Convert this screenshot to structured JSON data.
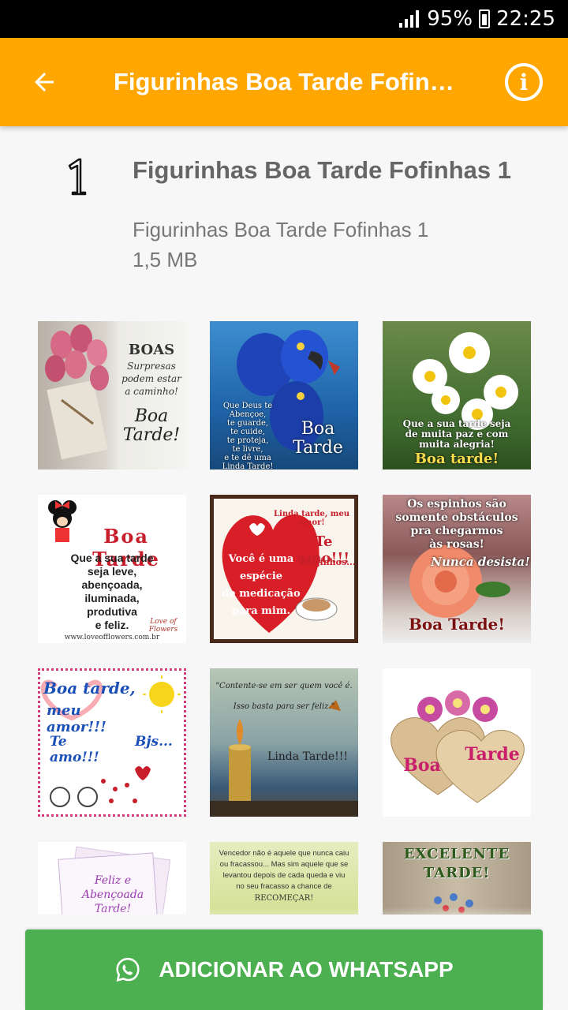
{
  "status_bar": {
    "battery": "95%",
    "time": "22:25"
  },
  "app_bar": {
    "title": "Figurinhas Boa Tarde Fofinhas 1"
  },
  "pack": {
    "tray_number": "1",
    "name": "Figurinhas Boa Tarde Fofinhas 1",
    "publisher": "Figurinhas Boa Tarde Fofinhas 1",
    "size": "1,5 MB"
  },
  "stickers": [
    {
      "name": "boas-surpresas",
      "lines": [
        "BOAS",
        "Surpresas",
        "podem estar",
        "a caminho!",
        "Boa",
        "Tarde!"
      ]
    },
    {
      "name": "araras-boa-tarde",
      "lines": [
        "Que Deus te",
        "Abençoe,",
        "te guarde,",
        "te cuide,",
        "te proteja,",
        "te livre,",
        "e te dê uma",
        "Linda Tarde!",
        "Boa",
        "Tarde"
      ]
    },
    {
      "name": "margaridas-boa-tarde",
      "lines": [
        "Que a sua tarde seja",
        "de muita paz e com",
        "muita alegria!",
        "Boa tarde!"
      ]
    },
    {
      "name": "minnie-boa-tarde",
      "lines": [
        "Boa Tarde",
        "Que a sua tarde",
        "seja leve,",
        "abençoada,",
        "iluminada,",
        "produtiva",
        "e feliz.",
        "Love of Flowers",
        "www.loveofflowers.com.br"
      ]
    },
    {
      "name": "coracao-medicacao",
      "lines": [
        "Linda tarde, meu amor!",
        "Te amo!!!",
        "Beijinhos...",
        "Você é uma espécie",
        "de medicação",
        "para mim."
      ]
    },
    {
      "name": "rosa-espinhos",
      "lines": [
        "Os espinhos são",
        "somente obstáculos",
        "pra chegarmos",
        "às rosas!",
        "Nunca desista!",
        "Boa Tarde!"
      ]
    },
    {
      "name": "meu-amor-bjs",
      "lines": [
        "Boa tarde,",
        "meu amor!!!",
        "Te amo!!!",
        "Bjs..."
      ]
    },
    {
      "name": "vela-linda-tarde",
      "lines": [
        "\"Contente-se em ser quem você é.",
        "Isso basta para ser feliz.\"",
        "Linda Tarde!!!"
      ]
    },
    {
      "name": "coracoes-rosas",
      "lines": [
        "Boa",
        "Tarde"
      ]
    },
    {
      "name": "feliz-abencoada",
      "lines": [
        "Feliz e",
        "Abençoada",
        "Tarde!"
      ]
    },
    {
      "name": "vencedor-recomecar",
      "lines": [
        "Vencedor não é aquele que nunca caiu",
        "ou fracassou... Mas sim aquele que se",
        "levantou depois de cada queda e viu",
        "no seu fracasso a chance de",
        "RECOMEÇAR!"
      ]
    },
    {
      "name": "excelente-tarde",
      "lines": [
        "EXCELENTE",
        "TARDE!"
      ]
    }
  ],
  "add_button": {
    "label": "ADICIONAR AO WHATSAPP"
  },
  "colors": {
    "app_bar": "#ffa700",
    "add_button": "#4caf50"
  }
}
